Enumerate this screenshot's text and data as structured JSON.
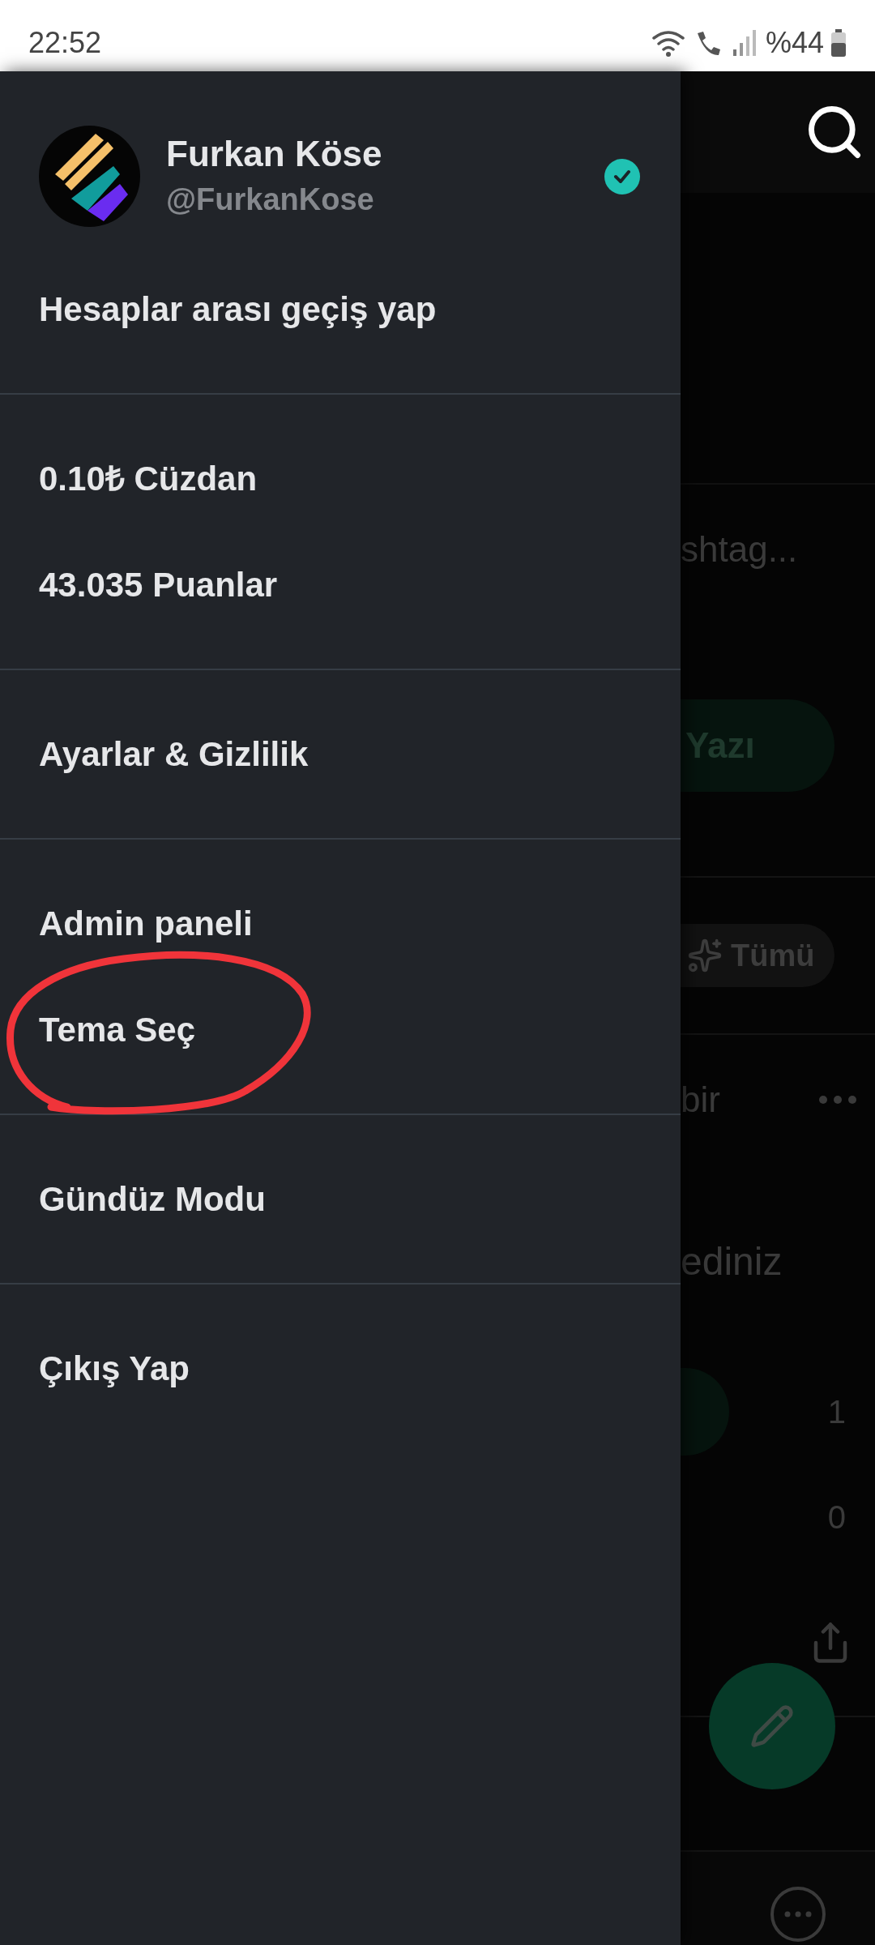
{
  "status_bar": {
    "time": "22:52",
    "battery": "%44"
  },
  "drawer": {
    "profile": {
      "name": "Furkan Köse",
      "handle": "@FurkanKose",
      "verified": true
    },
    "sections": [
      {
        "items": [
          {
            "label": "Hesaplar arası geçiş yap",
            "annotated": false
          }
        ]
      },
      {
        "items": [
          {
            "label": "0.10₺ Cüzdan",
            "annotated": false
          },
          {
            "label": "43.035 Puanlar",
            "annotated": false
          }
        ]
      },
      {
        "items": [
          {
            "label": "Ayarlar & Gizlilik",
            "annotated": false
          }
        ]
      },
      {
        "items": [
          {
            "label": "Admin paneli",
            "annotated": false
          },
          {
            "label": "Tema Seç",
            "annotated": true
          }
        ]
      },
      {
        "items": [
          {
            "label": "Gündüz Modu",
            "annotated": false
          }
        ]
      },
      {
        "items": [
          {
            "label": "Çıkış Yap",
            "annotated": false
          }
        ]
      }
    ]
  },
  "background": {
    "search_hint": "shtag...",
    "post_button": "Yazı",
    "filter_chip": "Tümü",
    "post_text_1": "bir",
    "post_text_2": "ediniz",
    "count_1": "1",
    "count_2": "0"
  }
}
